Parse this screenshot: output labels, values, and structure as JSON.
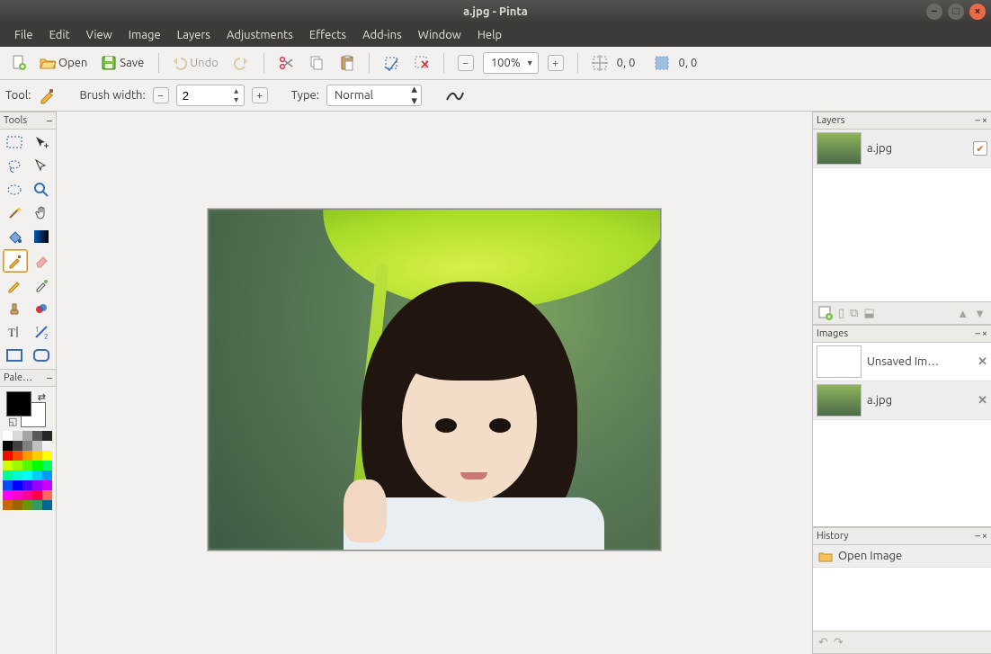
{
  "window": {
    "title": "a.jpg - Pinta"
  },
  "menu": {
    "file": "File",
    "edit": "Edit",
    "view": "View",
    "image": "Image",
    "layers": "Layers",
    "adjustments": "Adjustments",
    "effects": "Effects",
    "addins": "Add-ins",
    "window": "Window",
    "help": "Help"
  },
  "toolbar": {
    "new": "New",
    "open": "Open",
    "save": "Save",
    "undo": "Undo",
    "redo": "Redo",
    "zoom_value": "100%",
    "coord_left": "0, 0",
    "coord_right": "0, 0"
  },
  "tooloptions": {
    "tool_label": "Tool:",
    "brushwidth_label": "Brush width:",
    "brushwidth_value": "2",
    "type_label": "Type:",
    "type_value": "Normal"
  },
  "tools_panel": {
    "title": "Tools"
  },
  "palette_panel": {
    "title": "Pale…"
  },
  "palette_rows": [
    [
      "#ffffff",
      "#d9d9d9",
      "#a6a6a6",
      "#595959",
      "#262626"
    ],
    [
      "#000000",
      "#404040",
      "#7f7f7f",
      "#bfbfbf",
      "#f2f2f2"
    ],
    [
      "#ff0000",
      "#ff4d00",
      "#ff9900",
      "#ffcc00",
      "#ffff00"
    ],
    [
      "#ccff00",
      "#99ff00",
      "#4dff00",
      "#00ff00",
      "#00ff66"
    ],
    [
      "#00ff99",
      "#00ffcc",
      "#00ffff",
      "#00ccff",
      "#0099ff"
    ],
    [
      "#004dff",
      "#0000ff",
      "#4d00ff",
      "#9900ff",
      "#cc00ff"
    ],
    [
      "#ff00ff",
      "#ff00cc",
      "#ff0099",
      "#ff004d",
      "#ff6666"
    ],
    [
      "#cc6600",
      "#996600",
      "#669900",
      "#339966",
      "#006699"
    ]
  ],
  "layers": {
    "title": "Layers",
    "items": [
      {
        "name": "a.jpg",
        "visible": true,
        "has_image": true
      }
    ]
  },
  "images": {
    "title": "Images",
    "items": [
      {
        "name": "Unsaved Im…",
        "has_image": false,
        "closable": true,
        "selected": false
      },
      {
        "name": "a.jpg",
        "has_image": true,
        "closable": true,
        "selected": true
      }
    ]
  },
  "history": {
    "title": "History",
    "items": [
      {
        "name": "Open Image",
        "icon": "open"
      }
    ]
  }
}
